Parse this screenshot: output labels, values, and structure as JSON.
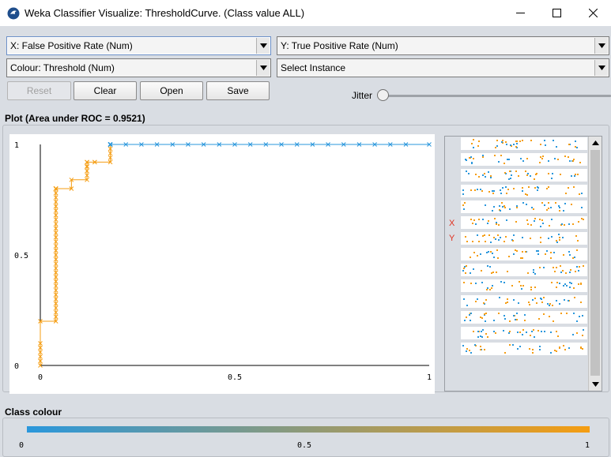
{
  "window": {
    "title": "Weka Classifier Visualize: ThresholdCurve. (Class value ALL)",
    "icon": "weka-bird-icon"
  },
  "controls": {
    "x_axis": "X: False Positive Rate (Num)",
    "y_axis": "Y: True Positive Rate (Num)",
    "colour": "Colour: Threshold (Num)",
    "instance": "Select Instance",
    "reset_label": "Reset",
    "clear_label": "Clear",
    "open_label": "Open",
    "save_label": "Save",
    "jitter_label": "Jitter",
    "jitter_value": 0
  },
  "plot": {
    "header": "Plot (Area under ROC = 0.9521)",
    "x_ticks": [
      "0",
      "0.5",
      "1"
    ],
    "y_ticks": [
      "1",
      "0.5",
      "0"
    ]
  },
  "chart_data": {
    "type": "line",
    "title": "Plot (Area under ROC = 0.9521)",
    "xlabel": "False Positive Rate",
    "ylabel": "True Positive Rate",
    "xlim": [
      0,
      1
    ],
    "ylim": [
      0,
      1
    ],
    "colour_by": "Threshold",
    "series": [
      {
        "x": [
          0,
          0,
          0,
          0,
          0,
          0,
          0,
          0.04,
          0.04,
          0.04,
          0.04,
          0.04,
          0.04,
          0.04,
          0.04,
          0.04,
          0.04,
          0.04,
          0.04,
          0.04,
          0.04,
          0.04,
          0.04,
          0.04,
          0.04,
          0.04,
          0.04,
          0.04,
          0.04,
          0.04,
          0.04,
          0.04,
          0.04,
          0.04,
          0.04,
          0.04,
          0.04,
          0.04,
          0.04,
          0.04,
          0.04,
          0.04,
          0.04,
          0.04,
          0.04,
          0.04,
          0.04,
          0.04,
          0.04,
          0.04,
          0.04,
          0.04,
          0.08,
          0.08,
          0.12,
          0.12,
          0.12,
          0.12,
          0.12,
          0.12,
          0.12,
          0.12,
          0.12,
          0.12,
          0.14,
          0.14,
          0.18,
          0.18,
          0.18,
          0.18,
          0.18,
          0.18,
          0.18,
          0.18,
          0.18,
          0.18,
          0.18,
          0.18,
          0.18,
          0.18,
          0.18,
          0.18,
          0.18,
          0.18,
          0.18,
          0.18,
          0.22,
          0.26,
          0.3,
          0.34,
          0.38,
          0.42,
          0.46,
          0.5,
          0.54,
          0.58,
          0.62,
          0.66,
          0.7,
          0.74,
          0.78,
          0.82,
          0.86,
          0.9,
          0.94,
          1.0
        ],
        "y": [
          0,
          0.02,
          0.04,
          0.06,
          0.08,
          0.1,
          0.2,
          0.2,
          0.22,
          0.24,
          0.26,
          0.28,
          0.3,
          0.32,
          0.34,
          0.36,
          0.38,
          0.4,
          0.42,
          0.44,
          0.46,
          0.48,
          0.5,
          0.52,
          0.54,
          0.56,
          0.58,
          0.6,
          0.62,
          0.64,
          0.66,
          0.68,
          0.7,
          0.72,
          0.74,
          0.76,
          0.78,
          0.8,
          0.8,
          0.8,
          0.8,
          0.8,
          0.8,
          0.8,
          0.8,
          0.8,
          0.8,
          0.8,
          0.8,
          0.8,
          0.8,
          0.8,
          0.8,
          0.84,
          0.84,
          0.86,
          0.88,
          0.9,
          0.9,
          0.9,
          0.9,
          0.9,
          0.92,
          0.92,
          0.92,
          0.92,
          0.92,
          0.94,
          0.96,
          0.98,
          1.0,
          1.0,
          1.0,
          1.0,
          1.0,
          1.0,
          1.0,
          1.0,
          1.0,
          1.0,
          1.0,
          1.0,
          1.0,
          1.0,
          1.0,
          1.0,
          1.0,
          1.0,
          1.0,
          1.0,
          1.0,
          1.0,
          1.0,
          1.0,
          1.0,
          1.0,
          1.0,
          1.0,
          1.0,
          1.0,
          1.0,
          1.0,
          1.0,
          1.0,
          1.0,
          1.0
        ]
      }
    ],
    "grid": false
  },
  "attribute_panel": {
    "x_marker": "X",
    "y_marker": "Y",
    "row_count": 14
  },
  "colour_legend": {
    "header": "Class colour",
    "ticks": [
      "0",
      "0.5",
      "1"
    ],
    "low_color": "#2a97dc",
    "high_color": "#f59d12"
  }
}
